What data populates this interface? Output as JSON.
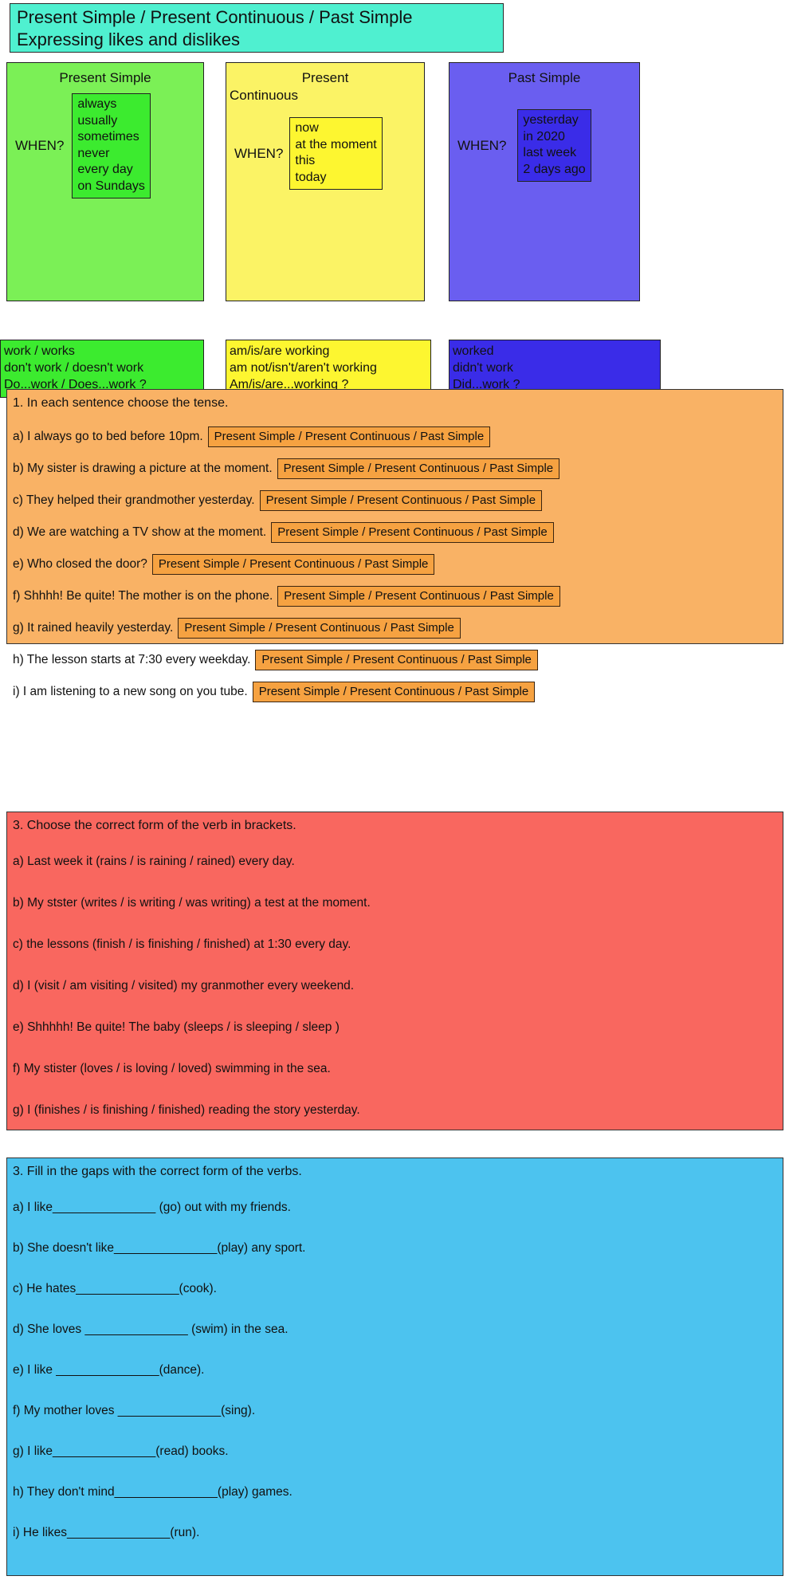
{
  "title": {
    "line1": "Present Simple / Present Continuous / Past Simple",
    "line2": "Expressing likes and dislikes"
  },
  "tenses": [
    {
      "name": "Present Simple",
      "when_label": "WHEN?",
      "time_expressions": [
        "always",
        "usually",
        "sometimes",
        "never",
        "every day",
        "on Sundays"
      ],
      "forms": [
        "work / works",
        "don't work / doesn't work",
        "Do...work / Does...work ?"
      ],
      "color": "#7bf056",
      "inner_color": "#3ceb2f"
    },
    {
      "name_line1": "Present",
      "name_line2": "Continuous",
      "name": "Present Continuous",
      "when_label": "WHEN?",
      "time_expressions": [
        "now",
        "at the moment",
        "this",
        "today"
      ],
      "forms": [
        "am/is/are working",
        "am not/isn't/aren't working",
        "Am/is/are...working ?"
      ],
      "color": "#fbf365",
      "inner_color": "#fdf630"
    },
    {
      "name": "Past Simple",
      "when_label": "WHEN?",
      "time_expressions": [
        "yesterday",
        "in 2020",
        "last week",
        "2 days ago"
      ],
      "forms": [
        "worked",
        "didn't work",
        "Did...work ?"
      ],
      "color": "#6a5ef0",
      "inner_color": "#3a2ce8"
    }
  ],
  "exercise1": {
    "title": "1. In each sentence choose the tense.",
    "choice_text": "Present Simple / Present Continuous / Past Simple",
    "items": [
      {
        "label": "a) I always go to bed before 10pm.",
        "choice": "Present Simple / Present Continuous / Past Simple"
      },
      {
        "label": "b) My sister is drawing a picture at the moment.",
        "choice": "Present Simple / Present Continuous / Past Simple"
      },
      {
        "label": "c) They helped their grandmother yesterday.",
        "choice": "Present Simple / Present Continuous / Past Simple"
      },
      {
        "label": "d) We are watching a TV show at the moment.",
        "choice": "Present Simple / Present Continuous / Past Simple"
      },
      {
        "label": "e) Who closed the door?",
        "choice": "Present Simple / Present Continuous / Past Simple"
      },
      {
        "label": "f) Shhhh! Be quite! The mother is on the phone.",
        "choice": "Present Simple / Present Continuous / Past Simple"
      },
      {
        "label": "g) It rained heavily yesterday.",
        "choice": "Present Simple / Present Continuous / Past Simple"
      },
      {
        "label": "h) The lesson starts at 7:30 every weekday.",
        "choice": "Present Simple / Present Continuous / Past Simple"
      },
      {
        "label": "i) I am listening to a new song on you tube.",
        "choice": "Present Simple / Present Continuous / Past Simple"
      }
    ]
  },
  "exercise2": {
    "title": "3. Choose the correct form of the verb in brackets.",
    "items": [
      "a) Last week it (rains / is raining / rained) every day.",
      "b) My stster (writes / is writing / was writing) a test at the moment.",
      "c) the lessons (finish / is finishing / finished) at 1:30 every day.",
      "d) I (visit / am visiting / visited) my granmother every weekend.",
      "e) Shhhhh! Be quite! The baby (sleeps / is sleeping / sleep )",
      "f) My stister (loves / is loving / loved) swimming in the sea.",
      "g) I (finishes / is finishing / finished) reading the story yesterday."
    ]
  },
  "exercise3": {
    "title": "3. Fill in the gaps with the correct form of the verbs.",
    "items": [
      "a) I like_______________ (go) out with my friends.",
      "b) She doesn't like_______________(play) any sport.",
      "c) He hates_______________(cook).",
      "d)  She loves _______________ (swim) in the sea.",
      "e) I like _______________(dance).",
      "f) My mother loves _______________(sing).",
      "g) I like_______________(read) books.",
      "h) They don't mind_______________(play) games.",
      "i) He likes_______________(run)."
    ]
  }
}
